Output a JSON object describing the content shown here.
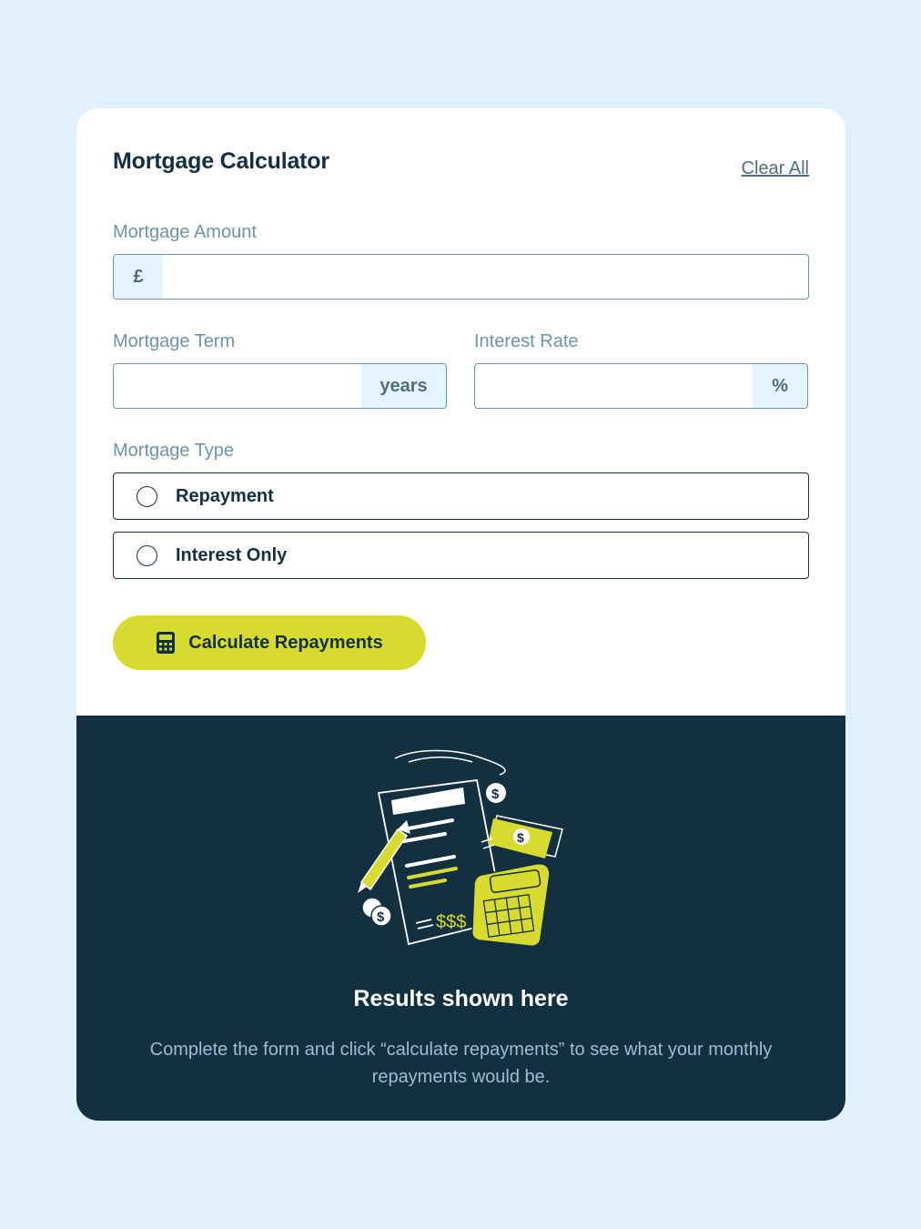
{
  "header": {
    "title": "Mortgage Calculator",
    "clear_label": "Clear All"
  },
  "amount": {
    "label": "Mortgage Amount",
    "prefix": "£",
    "value": ""
  },
  "term": {
    "label": "Mortgage Term",
    "suffix": "years",
    "value": ""
  },
  "rate": {
    "label": "Interest Rate",
    "suffix": "%",
    "value": ""
  },
  "type": {
    "label": "Mortgage Type",
    "options": [
      {
        "label": "Repayment",
        "selected": false
      },
      {
        "label": "Interest Only",
        "selected": false
      }
    ]
  },
  "submit": {
    "label": "Calculate Repayments",
    "icon": "calculator-icon"
  },
  "results": {
    "title": "Results shown here",
    "text": "Complete the form and click “calculate repayments” to see what your monthly repayments would be.",
    "illustration": "empty-results-illustration"
  },
  "colors": {
    "page_bg": "#E0F0FC",
    "dark": "#133041",
    "accent": "#D7DA2F",
    "muted": "#6B94A8",
    "affix_bg": "#E4F4FD"
  }
}
